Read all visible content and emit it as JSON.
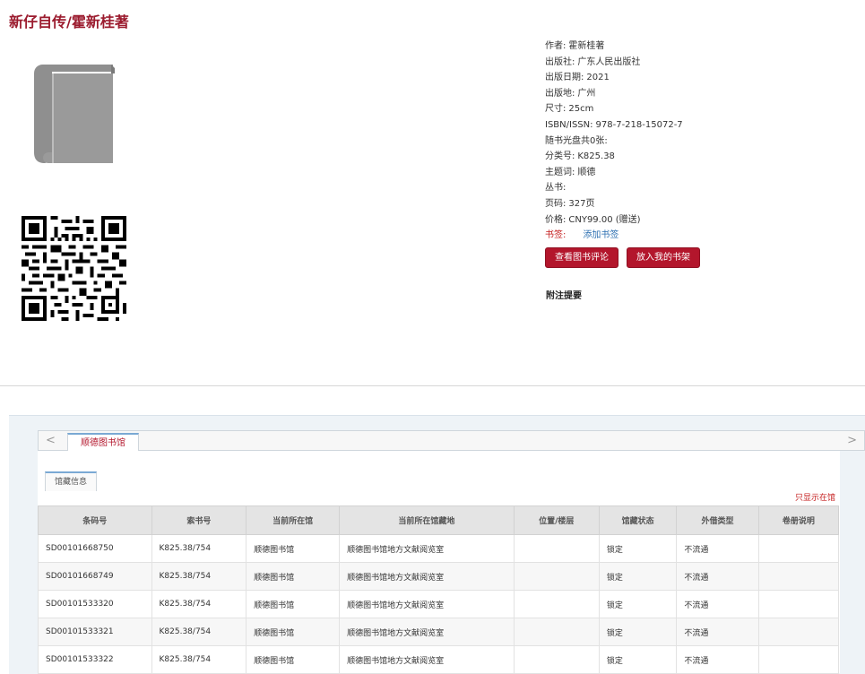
{
  "title": "新仔自传/霍新桂著",
  "meta": {
    "author": {
      "label": "作者:",
      "value": "霍新桂著"
    },
    "publisher": {
      "label": "出版社:",
      "value": "广东人民出版社"
    },
    "pub_date": {
      "label": "出版日期:",
      "value": "2021"
    },
    "pub_place": {
      "label": "出版地:",
      "value": "广州"
    },
    "size": {
      "label": "尺寸:",
      "value": "25cm"
    },
    "isbn": {
      "label": "ISBN/ISSN:",
      "value": "978-7-218-15072-7"
    },
    "disc": {
      "label": "随书光盘共0张:",
      "value": ""
    },
    "class_no": {
      "label": "分类号:",
      "value": "K825.38"
    },
    "subject": {
      "label": "主题词:",
      "value": "顺德"
    },
    "series": {
      "label": "丛书:",
      "value": ""
    },
    "pages": {
      "label": "页码:",
      "value": "327页"
    },
    "price": {
      "label": "价格:",
      "value": "CNY99.00 (赠送)"
    },
    "bookmark": {
      "label": "书签:",
      "link": "添加书签"
    }
  },
  "buttons": {
    "review": "查看图书评论",
    "shelf": "放入我的书架"
  },
  "note_title": "附注提要",
  "tabs": {
    "library": "顺德图书馆",
    "holdings": "馆藏信息",
    "prev_arrow": "<",
    "next_arrow": ">"
  },
  "show_link": "只显示在馆",
  "table": {
    "headers": [
      "条码号",
      "索书号",
      "当前所在馆",
      "当前所在馆藏地",
      "位置/楼层",
      "馆藏状态",
      "外借类型",
      "卷册说明"
    ],
    "rows": [
      [
        "SD00101668750",
        "K825.38/754",
        "顺德图书馆",
        "顺德图书馆地方文献阅览室",
        "",
        "锁定",
        "不流通",
        ""
      ],
      [
        "SD00101668749",
        "K825.38/754",
        "顺德图书馆",
        "顺德图书馆地方文献阅览室",
        "",
        "锁定",
        "不流通",
        ""
      ],
      [
        "SD00101533320",
        "K825.38/754",
        "顺德图书馆",
        "顺德图书馆地方文献阅览室",
        "",
        "锁定",
        "不流通",
        ""
      ],
      [
        "SD00101533321",
        "K825.38/754",
        "顺德图书馆",
        "顺德图书馆地方文献阅览室",
        "",
        "锁定",
        "不流通",
        ""
      ],
      [
        "SD00101533322",
        "K825.38/754",
        "顺德图书馆",
        "顺德图书馆地方文献阅览室",
        "",
        "锁定",
        "不流通",
        ""
      ]
    ]
  },
  "colors": {
    "brand_red": "#b3162c",
    "title_red": "#9b1b2e",
    "link_blue": "#2c6fb1"
  },
  "icons": {
    "book": "book-icon",
    "qr": "qr-code"
  }
}
